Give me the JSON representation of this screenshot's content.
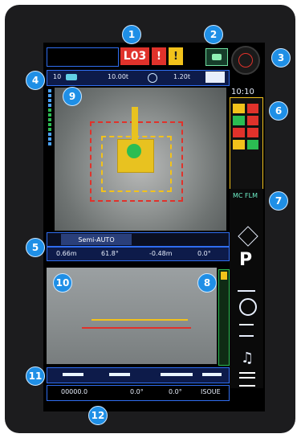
{
  "callouts": [
    "1",
    "2",
    "3",
    "4",
    "5",
    "6",
    "7",
    "8",
    "9",
    "10",
    "11",
    "12"
  ],
  "header": {
    "code": "L03",
    "alert_glyph": "!",
    "warn_glyph": "!"
  },
  "status_row": {
    "value1": "10",
    "value2": "10.00t",
    "value3": "1.20t"
  },
  "clock": "10:10",
  "mode": {
    "label": "Semi-AUTO",
    "readings": [
      "0.66m",
      "61.8°",
      "-0.48m",
      "0.0°"
    ]
  },
  "right_panel": {
    "mc_label": "MC",
    "flm_label": "FLM",
    "p_label": "P"
  },
  "bottom": {
    "counter": "00000.0",
    "angle1": "0.0°",
    "angle2": "0.0°",
    "status_text": "ISOUE"
  },
  "colors": {
    "accent_blue": "#2f6df0",
    "alert_red": "#e0322b",
    "warn_yellow": "#f2c21b",
    "status_green": "#2bbd52"
  }
}
